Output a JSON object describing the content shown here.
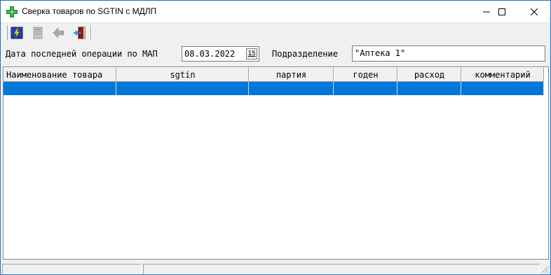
{
  "window": {
    "title": "Сверка товаров по SGTIN с МДЛП",
    "icon": "green-cross-icon"
  },
  "toolbar": {
    "items": [
      {
        "icon": "lightning-icon",
        "enabled": true
      },
      {
        "icon": "document-icon",
        "enabled": false
      },
      {
        "icon": "arrow-left-icon",
        "enabled": false
      },
      {
        "icon": "exit-door-icon",
        "enabled": true
      }
    ]
  },
  "filters": {
    "date_label": "Дата последней операции по МАП",
    "date_value": "08.03.2022",
    "calendar_day": "15",
    "division_label": "Подразделение",
    "division_value": "\"Аптека 1\""
  },
  "table": {
    "columns": [
      "Наименование товара",
      "sgtin",
      "партия",
      "годен",
      "расход",
      "комментарий"
    ],
    "selection_color": "#0078d7",
    "rows": [
      [
        "",
        "",
        "",
        "",
        "",
        ""
      ]
    ]
  }
}
